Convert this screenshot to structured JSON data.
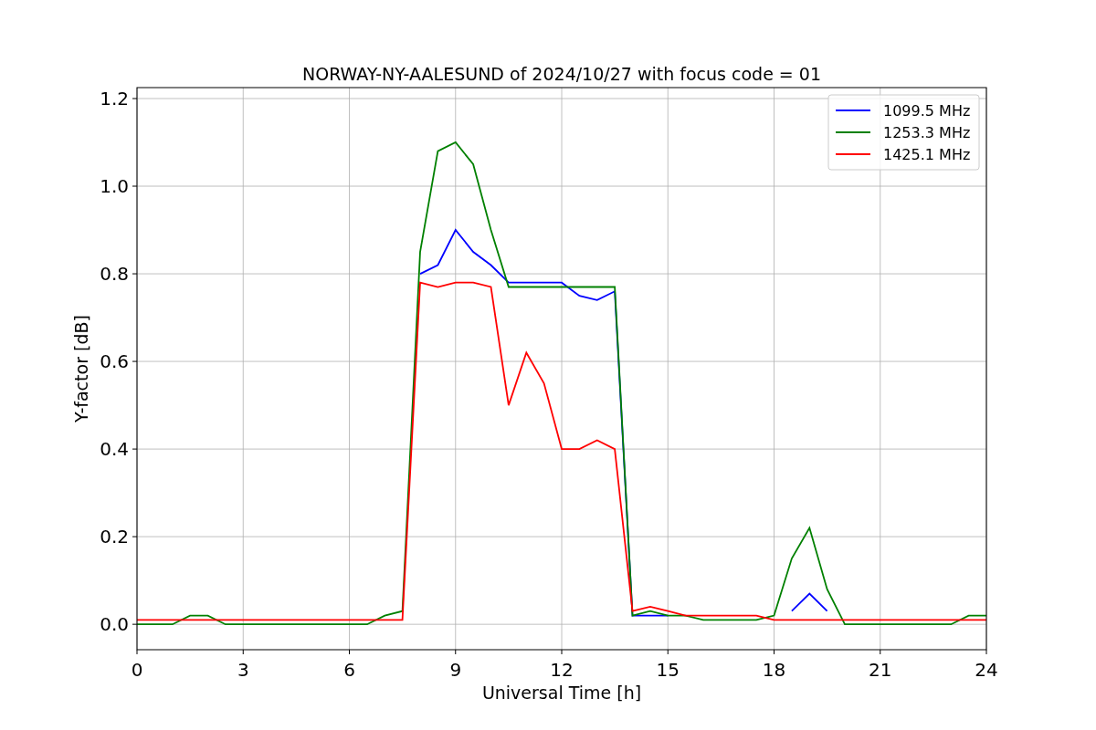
{
  "chart_data": {
    "type": "line",
    "title": "NORWAY-NY-AALESUND of 2024/10/27 with focus code = 01",
    "xlabel": "Universal Time [h]",
    "ylabel": "Y-factor [dB]",
    "x": [
      0,
      0.5,
      1,
      1.5,
      2,
      2.5,
      3,
      3.5,
      4,
      4.5,
      5,
      5.5,
      6,
      6.5,
      7,
      7.5,
      8,
      8.5,
      9,
      9.5,
      10,
      10.5,
      11,
      11.5,
      12,
      12.5,
      13,
      13.5,
      14,
      14.5,
      15,
      15.5,
      16,
      16.5,
      17,
      17.5,
      18,
      18.5,
      19,
      19.5,
      20,
      20.5,
      21,
      21.5,
      22,
      22.5,
      23,
      23.5,
      24
    ],
    "series": [
      {
        "name": "1099.5 MHz",
        "color": "#0000ff",
        "values": [
          null,
          null,
          null,
          null,
          null,
          null,
          null,
          null,
          null,
          null,
          null,
          null,
          null,
          null,
          null,
          null,
          0.8,
          0.82,
          0.9,
          0.85,
          0.82,
          0.78,
          0.78,
          0.78,
          0.78,
          0.75,
          0.74,
          0.76,
          0.02,
          0.02,
          0.02,
          null,
          null,
          null,
          null,
          null,
          null,
          0.03,
          0.07,
          0.03,
          null,
          null,
          null,
          null,
          null,
          null,
          null,
          null,
          null
        ]
      },
      {
        "name": "1253.3 MHz",
        "color": "#008000",
        "values": [
          0,
          0,
          0,
          0.02,
          0.02,
          0,
          0,
          0,
          0,
          0,
          0,
          0,
          0,
          0,
          0.02,
          0.03,
          0.85,
          1.08,
          1.1,
          1.05,
          0.9,
          0.77,
          0.77,
          0.77,
          0.77,
          0.77,
          0.77,
          0.77,
          0.02,
          0.03,
          0.02,
          0.02,
          0.01,
          0.01,
          0.01,
          0.01,
          0.02,
          0.15,
          0.22,
          0.08,
          0,
          0,
          0,
          0,
          0,
          0,
          0,
          0.02,
          0.02
        ]
      },
      {
        "name": "1425.1 MHz",
        "color": "#ff0000",
        "values": [
          0.01,
          0.01,
          0.01,
          0.01,
          0.01,
          0.01,
          0.01,
          0.01,
          0.01,
          0.01,
          0.01,
          0.01,
          0.01,
          0.01,
          0.01,
          0.01,
          0.78,
          0.77,
          0.78,
          0.78,
          0.77,
          0.5,
          0.62,
          0.55,
          0.4,
          0.4,
          0.42,
          0.4,
          0.03,
          0.04,
          0.03,
          0.02,
          0.02,
          0.02,
          0.02,
          0.02,
          0.01,
          0.01,
          0.01,
          0.01,
          0.01,
          0.01,
          0.01,
          0.01,
          0.01,
          0.01,
          0.01,
          0.01,
          0.01
        ]
      }
    ],
    "xlim": [
      0,
      24
    ],
    "ylim": [
      -0.058,
      1.225
    ],
    "xticks": [
      0,
      3,
      6,
      9,
      12,
      15,
      18,
      21,
      24
    ],
    "yticks": [
      {
        "value": 0,
        "label": "0.0"
      },
      {
        "value": 0.2,
        "label": "0.2"
      },
      {
        "value": 0.4,
        "label": "0.4"
      },
      {
        "value": 0.6,
        "label": "0.6"
      },
      {
        "value": 0.8,
        "label": "0.8"
      },
      {
        "value": 1,
        "label": "1.0"
      },
      {
        "value": 1.2,
        "label": "1.2"
      }
    ],
    "grid": true,
    "legend": true
  }
}
